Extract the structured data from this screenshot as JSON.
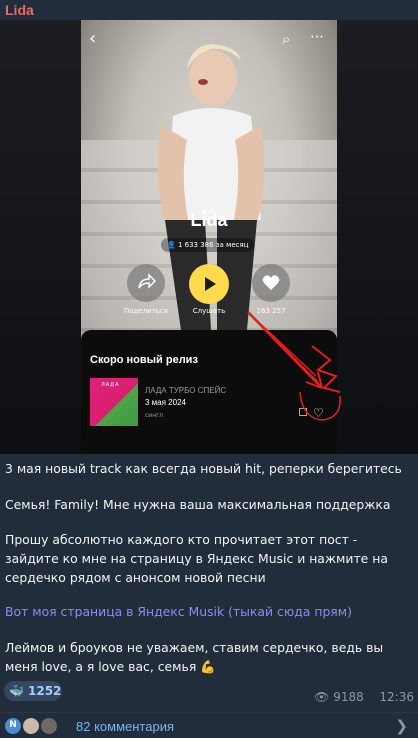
{
  "channel": {
    "name": "Lida"
  },
  "media": {
    "artist_name": "Lida",
    "listeners": "1 633 386 за месяц",
    "share_label": "Поделиться",
    "listen_label": "Слушать",
    "likes_label": "163 257",
    "release_section_title": "Скоро новый релиз",
    "cover_logo": "ЛАДА",
    "release_name": "ЛАДА ТУРБО СПЕЙС",
    "release_date": "3 мая 2024",
    "release_type": "сингл",
    "icons": [
      "back-icon",
      "search-icon",
      "more-icon",
      "share-icon",
      "play-icon",
      "heart-icon"
    ]
  },
  "message": {
    "line1": "3 мая новый track как всегда новый hit, реперки берегитесь",
    "line2": "Семья! Family! Мне нужна ваша максимальная поддержка",
    "line3": "Прошу абсолютно каждого кто прочитает этот пост - зайдите ко мне на страницу в Яндекс Music и нажмите на сердечко рядом с анонсом новой песни",
    "link": "Вот моя страница в Яндекс Musik (тыкай сюда прям)",
    "line4": "Леймов и броуков не уважаем, ставим сердечко, ведь вы меня love, а я love вас, семья 💪"
  },
  "reaction": {
    "emoji": "🐳",
    "count": "1252"
  },
  "meta": {
    "views": "9188",
    "time": "12:36"
  },
  "comments": {
    "label": "82 комментария",
    "avatar_letter": "N"
  },
  "colors": {
    "channel_name": "#e86a6a",
    "link": "#8e8cf2",
    "comments": "#73b7f7",
    "bubble": "#212d3b",
    "play_button": "#ffdb4d"
  }
}
